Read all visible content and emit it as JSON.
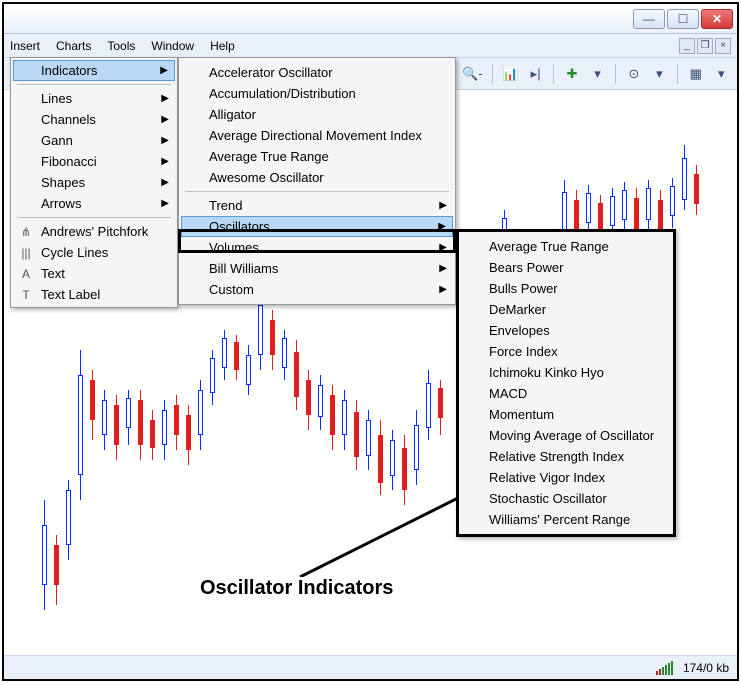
{
  "menubar": {
    "insert": "Insert",
    "charts": "Charts",
    "tools": "Tools",
    "window": "Window",
    "help": "Help"
  },
  "insert_menu": {
    "indicators": "Indicators",
    "lines": "Lines",
    "channels": "Channels",
    "gann": "Gann",
    "fibonacci": "Fibonacci",
    "shapes": "Shapes",
    "arrows": "Arrows",
    "pitchfork": "Andrews' Pitchfork",
    "cycle_lines": "Cycle Lines",
    "text": "Text",
    "text_label": "Text Label"
  },
  "indicators_submenu": {
    "accelerator": "Accelerator Oscillator",
    "accumulation": "Accumulation/Distribution",
    "alligator": "Alligator",
    "adx": "Average Directional Movement Index",
    "atr": "Average True Range",
    "awesome": "Awesome Oscillator",
    "trend": "Trend",
    "oscillators": "Oscillators",
    "volumes": "Volumes",
    "bill_williams": "Bill Williams",
    "custom": "Custom"
  },
  "oscillators_submenu": {
    "atr": "Average True Range",
    "bears": "Bears Power",
    "bulls": "Bulls Power",
    "demarker": "DeMarker",
    "envelopes": "Envelopes",
    "force": "Force Index",
    "ichimoku": "Ichimoku Kinko Hyo",
    "macd": "MACD",
    "momentum": "Momentum",
    "mao": "Moving Average of Oscillator",
    "rsi": "Relative Strength Index",
    "rvi": "Relative Vigor Index",
    "stochastic": "Stochastic Oscillator",
    "wpr": "Williams' Percent Range"
  },
  "callout": "Oscillator Indicators",
  "status": {
    "connection": "174/0 kb"
  }
}
